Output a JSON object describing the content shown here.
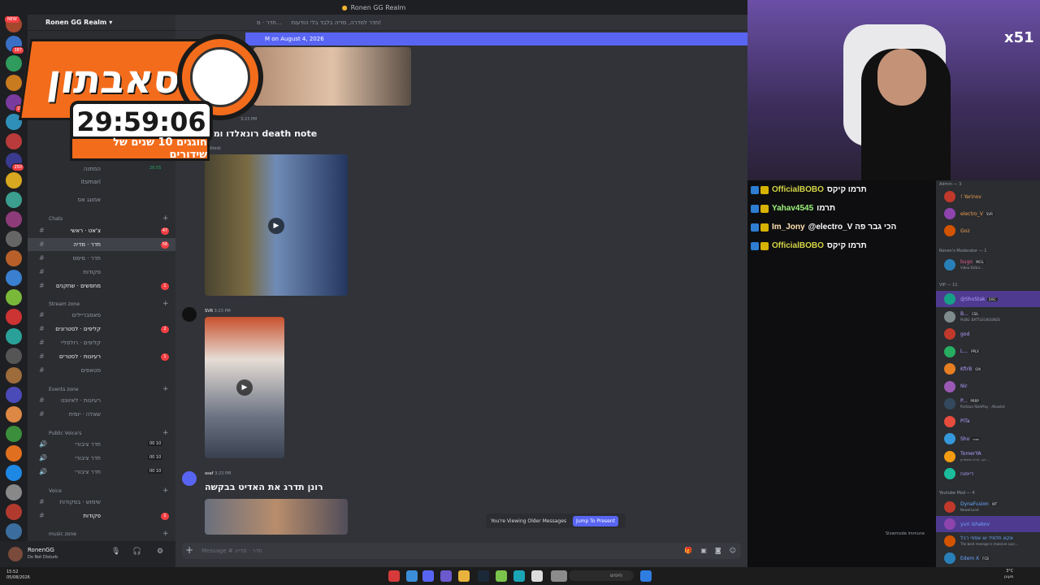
{
  "app": {
    "title": "Ronen GG Realm",
    "guild_name": "Ronen GG Realm",
    "new_label": "NEW"
  },
  "channel_header": {
    "name": "חדר · מ...",
    "topic": "חדר לסדרה, מדיה בלבד בלי הודעות!"
  },
  "new_messages_bar": "M on August 4, 2026",
  "sidebar": {
    "voice_items": [
      {
        "label": "המתנה",
        "count": "26:55"
      },
      {
        "label": "itsmari"
      },
      {
        "label": "אמונג אס"
      }
    ],
    "categories": {
      "chats": "Chats",
      "stream": "Stream zone",
      "events": "Events zone",
      "public_voice": "Public Voice's",
      "voice": "Voice",
      "music": "music zone"
    },
    "chats": [
      {
        "label": "צ'אט · ראשי",
        "badge": "47"
      },
      {
        "label": "חדר · מדיה",
        "badge": "56"
      },
      {
        "label": "חדר · מימס"
      },
      {
        "label": "פקודות"
      },
      {
        "label": "מחפשים · שחקנים",
        "badge": "1"
      }
    ],
    "stream": [
      {
        "label": "סאמבריילים"
      },
      {
        "label": "קליפים · לסטרונים",
        "badge": "2"
      },
      {
        "label": "קליפים · רולפליי"
      },
      {
        "label": "רעיונות · לסטרים",
        "badge": "1"
      },
      {
        "label": "סטאפים"
      }
    ],
    "events": [
      {
        "label": "רעיונות · לאיוונט"
      },
      {
        "label": "שאלה · יומית"
      }
    ],
    "public_voice": [
      {
        "label": "חדר ציבורי",
        "cnt": "00 10"
      },
      {
        "label": "חדר ציבורי",
        "cnt": "00 10"
      },
      {
        "label": "חדר ציבורי",
        "cnt": "00 10"
      }
    ],
    "voice": [
      {
        "label": "שימוש · בפקודות"
      },
      {
        "label": "פקודות",
        "badge": "1"
      }
    ]
  },
  "server_badges": [
    "387",
    "19",
    "250",
    "164",
    "183",
    "520",
    "58",
    "203",
    "41",
    "387"
  ],
  "user": {
    "name": "RonenGG",
    "status": "Do Not Disturb"
  },
  "messages": [
    {
      "title": "רונאלדו ומסי death note",
      "meta": "3:23 PM",
      "sub": "(edited)"
    },
    {
      "author": "SVR",
      "time": "3:23 PM"
    },
    {
      "author": "asaf",
      "time": "3:23 PM",
      "title": "רונן תדרג את האדיט בבקשה"
    }
  ],
  "older_bar": {
    "text": "You're Viewing Older Messages",
    "button": "Jump To Present"
  },
  "composer": {
    "placeholder": "Message # חדר · מדיה"
  },
  "slowmode": "Slowmode immune",
  "overlay": {
    "brand": "סאבתון",
    "timer": "29:59:06",
    "ribbon": "חוגגים 10 שנים של שידורים",
    "multiplier": "x51"
  },
  "stream_chat": [
    {
      "user": "OfficialBOBO",
      "msg": "תרמו קיקס"
    },
    {
      "user": "Yahav4545",
      "msg": "תרמו"
    },
    {
      "user": "Im_Jony",
      "msg": "@electro_V הכי גבר פה"
    },
    {
      "user": "OfficialBOBO",
      "msg": "תרמו קיקס"
    }
  ],
  "members": {
    "admin_cat": "Admin — 3",
    "admins": [
      {
        "name": "! Yarinov"
      },
      {
        "name": "electro_V",
        "tag": "SVR"
      },
      {
        "name": "Goz"
      }
    ],
    "mod_cat": "Ronen's Moderator — 1",
    "mods": [
      {
        "name": "bugo",
        "tag": "MCIL",
        "sub": "Video Editor..."
      }
    ],
    "vip_cat": "VIP — 11",
    "vips": [
      {
        "name": "@ShoStak",
        "tag": "DISC"
      },
      {
        "name": "B...",
        "tag": "CSIL",
        "sub": "PUBG: BATTLEGROUNDS"
      },
      {
        "name": "god"
      },
      {
        "name": "L...",
        "tag": "PPLX"
      },
      {
        "name": "KfirB",
        "tag": "OAI"
      },
      {
        "name": "Nir"
      },
      {
        "name": "P...",
        "tag": "PRRP",
        "sub": "Partizan RolePlay - Allowlist"
      },
      {
        "name": "PiTa"
      },
      {
        "name": "Sho",
        "tag": "שבט"
      },
      {
        "name": "TomerYA",
        "sub": "קר, בריא ומשתרע..."
      },
      {
        "name": "דיימונז"
      }
    ],
    "yt_cat": "Youtube Mod — 4",
    "yt": [
      {
        "name": "DynaFusion",
        "tag": "WT",
        "sub": "NewerLand"
      },
      {
        "name": "yuri ishakov"
      },
      {
        "name": "אקא תלמיד וא אספי רבל",
        "sub": "The best revenge is massive succ..."
      },
      {
        "name": "Edem X",
        "tag": "FCB"
      }
    ]
  },
  "taskbar": {
    "search": "חיפוש",
    "time_left": "15:52\n05/08/2026",
    "time_right": "3°C\nמעונן"
  },
  "colors": {
    "blurple": "#5865f2",
    "bg_main": "#313338",
    "bg_side": "#2b2d31",
    "brand_orange": "#f36c1b",
    "badge_red": "#f23f43"
  }
}
